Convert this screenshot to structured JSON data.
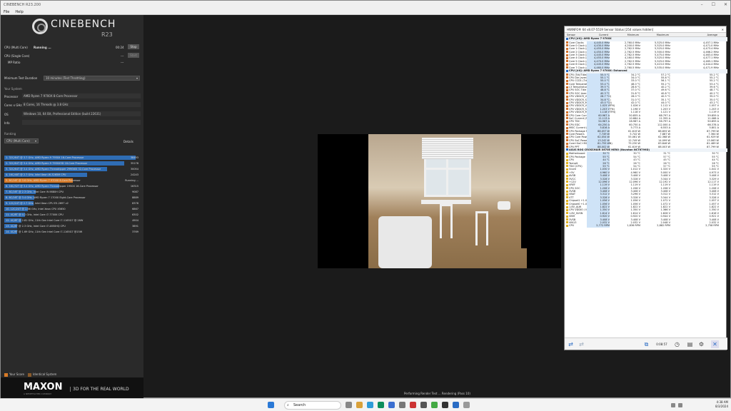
{
  "cinebench": {
    "window_title": "CINEBENCH R23.200",
    "menu": [
      "File",
      "Help"
    ],
    "brand": "CINEBENCH",
    "version": "R23",
    "multi_label": "CPU (Multi Core)",
    "multi_status": "Running ...",
    "multi_time": "00:24",
    "stop": "Stop",
    "single_label": "CPU (Single Core)",
    "single_value": "---",
    "start": "Start",
    "mp_label": "MP Ratio",
    "mp_value": "---",
    "min_test_label": "Minimum Test Duration",
    "min_test_value": "10 minutes (Test Throttling)",
    "system_label": "Your System",
    "processor_label": "Processor",
    "processor_value": "AMD Ryzen 7 9700X 8-Core Processor",
    "cores_label": "Cores x GHz",
    "cores_value": "8 Cores, 16 Threads @ 3.8 GHz",
    "os_label": "OS",
    "os_value": "Windows 10, 64 Bit, Professional Edition (build 22631)",
    "info_label": "Info",
    "info_value": "",
    "ranking_label": "Ranking",
    "ranking_select": "CPU (Multi Core)",
    "details": "Details",
    "ranking": [
      {
        "name": "1. 32C/64T @ 3.7 GHz, AMD Ryzen 9 7950X 16-Core Processor",
        "score": "38493",
        "pct": 100,
        "me": false
      },
      {
        "name": "2. 32C/64T @ 3.4 GHz, AMD Ryzen 9 7950X3D 16-Core Processor",
        "score": "35178",
        "pct": 91,
        "me": false
      },
      {
        "name": "3. 32C/64T @ 3.4 GHz, AMD Ryzen Threadripper 2990WX 32-Core Processor",
        "score": "30054",
        "pct": 78,
        "me": false
      },
      {
        "name": "4. 16C/48T @ 2.7 GHz, Intel Xeon W-3265M CPU",
        "score": "24243",
        "pct": 63,
        "me": false
      },
      {
        "name": "5. 8C/16T @ 3.8 GHz, AMD Ryzen 7 9700X 8-Core Processor",
        "score": "Running ...",
        "pct": 52,
        "me": true
      },
      {
        "name": "6. 16C/32T @ 3.4 GHz, AMD Ryzen Threadripper 1950X 16-Core Processor",
        "score": "16315",
        "pct": 42,
        "me": false
      },
      {
        "name": "7. 8C/16T @ 2.3 GHz, Intel Core i9-9880H CPU",
        "score": "9087",
        "pct": 24,
        "me": false
      },
      {
        "name": "8. 8C/16T @ 3.4 GHz, AMD Ryzen 7 1700X Eight-Core Processor",
        "score": "8889",
        "pct": 23,
        "me": false
      },
      {
        "name": "9. 12C/24T @ 2.7 GHz, Intel Xeon CPU E5-2697 v2",
        "score": "8378",
        "pct": 22,
        "me": false
      },
      {
        "name": "10. 12C/24T @ 2.66 GHz, Intel Xeon CPU X5650",
        "score": "6867",
        "pct": 18,
        "me": false
      },
      {
        "name": "11. 4C/8T @ 4.2 GHz, Intel Core i7-7700K CPU",
        "score": "6302",
        "pct": 16,
        "me": false
      },
      {
        "name": "12. 4C/8T @ 2.81 GHz, 11th Gen Intel Core i7-1165G7 @ 28W",
        "score": "4904",
        "pct": 13,
        "me": false
      },
      {
        "name": "13. 4C/8T @ 2.3 GHz, Intel Core i7-4850HQ CPU",
        "score": "3891",
        "pct": 10,
        "me": false
      },
      {
        "name": "14. 4C/8T @ 1.69 GHz, 11th Gen Intel Core i7-1165G7 @15W",
        "score": "3769",
        "pct": 10,
        "me": false
      }
    ],
    "legend_score": "Your Score",
    "legend_identical": "Identical System",
    "maxon": "MAXON",
    "maxon_sub": "A NEMETSCHEK COMPANY",
    "slogan": "3D FOR THE REAL WORLD",
    "status": "Performing Render Test ... Rendering (Pass 10)"
  },
  "hwinfo": {
    "title": "HWiNFO® 64 v8.07-5519 Sensor Status [254 values hidden]",
    "headers": [
      "Sensor",
      "Current",
      "Minimum",
      "Maximum",
      "Average"
    ],
    "rows": [
      {
        "g": true,
        "n": "CPU [#0]: AMD Ryzen 7 9700X"
      },
      {
        "n": "Core Clocks",
        "v": [
          "4,445.0 MHz",
          "2,760.0 MHz",
          "5,525.0 MHz",
          "4,457.1 MHz"
        ]
      },
      {
        "n": "Core 0 Clock (perf #1)",
        "v": [
          "4,430.0 MHz",
          "4,200.0 MHz",
          "5,525.0 MHz",
          "4,471.0 MHz"
        ]
      },
      {
        "n": "Core 1 Clock (perf #1)",
        "v": [
          "4,455.0 MHz",
          "2,762.5 MHz",
          "5,525.0 MHz",
          "4,473.4 MHz"
        ]
      },
      {
        "n": "Core 2 Clock (perf #2)",
        "v": [
          "4,450.0 MHz",
          "2,762.5 MHz",
          "5,500.0 MHz",
          "4,466.2 MHz"
        ]
      },
      {
        "n": "Core 3 Clock (perf #3)",
        "v": [
          "4,445.0 MHz",
          "2,762.5 MHz",
          "5,475.0 MHz",
          "4,463.4 MHz"
        ]
      },
      {
        "n": "Core 4 Clock (perf #1)",
        "v": [
          "4,455.0 MHz",
          "4,160.0 MHz",
          "5,525.0 MHz",
          "4,477.1 MHz"
        ]
      },
      {
        "n": "Core 5 Clock (perf #1)",
        "v": [
          "4,470.0 MHz",
          "2,762.5 MHz",
          "5,525.0 MHz",
          "4,465.1 MHz"
        ]
      },
      {
        "n": "Core 6 Clock (perf #4)",
        "v": [
          "4,445.0 MHz",
          "2,762.5 MHz",
          "5,415.0 MHz",
          "4,444.4 MHz"
        ]
      },
      {
        "n": "Core 7 Clock (perf #5)",
        "v": [
          "4,460.0 MHz",
          "2,760.5 MHz",
          "5,535.0 MHz",
          "4,471.9 MHz"
        ]
      },
      {
        "g": true,
        "n": "CPU [#0]: AMD Ryzen 7 9700X: Enhanced"
      },
      {
        "n": "CPU (Tctl/Tdie)",
        "v": [
          "55.5 °C",
          "34.2 °C",
          "57.2 °C",
          "55.2 °C"
        ]
      },
      {
        "n": "CPU Die (average)",
        "v": [
          "55.1 °C",
          "34.0 °C",
          "55.8 °C",
          "55.2 °C"
        ]
      },
      {
        "n": "CPU CCD1 (Tdie)",
        "v": [
          "55.0 °C",
          "33.0 °C",
          "56.1 °C",
          "55.2 °C"
        ]
      },
      {
        "n": "Core Temperatures",
        "v": [
          "53.4 °C",
          "48.0 °C",
          "55.2 °C",
          "53.4 °C"
        ]
      },
      {
        "n": "L3 Temperatures",
        "v": [
          "39.5 °C",
          "28.6 °C",
          "40.2 °C",
          "39.6 °C"
        ]
      },
      {
        "n": "CPU SOC Tdie",
        "v": [
          "48.8 °C",
          "37.0 °C",
          "49.6 °C",
          "48.7 °C"
        ]
      },
      {
        "n": "CPU SOC Average",
        "v": [
          "40.3 °C",
          "31.8 °C",
          "40.8 °C",
          "40.2 °C"
        ]
      },
      {
        "n": "CPU VDDCR_VDD VRM (SVI3 TFN)",
        "v": [
          "28.7 °C",
          "28.0 °C",
          "40.5 °C",
          "35.0 °C"
        ]
      },
      {
        "n": "CPU VDDCR_SOC VRM (SVI3 TFN)",
        "v": [
          "34.8 °C",
          "31.0 °C",
          "35.1 °C",
          "35.0 °C"
        ]
      },
      {
        "n": "CPU VDDCR_MISC VRM (SVI3 TFN)",
        "v": [
          "43.0 °C",
          "42.0 °C",
          "44.0 °C",
          "43.2 °C"
        ]
      },
      {
        "n": "CPU VDDCR_VDD Voltage (SVI3 TFN)",
        "v": [
          "1.025 V",
          "1.026 V",
          "1.112 V",
          "1.057 V"
        ]
      },
      {
        "n": "CPU VDDCR_SOC Voltage (SVI3 TFN)",
        "v": [
          "1.203 V",
          "1.198 V",
          "1.203 V",
          "1.203 V"
        ]
      },
      {
        "n": "CPU VDDCR_MISC Voltage (SVI3 TFN)",
        "v": [
          "1.118 V",
          "1.118 V",
          "1.121 V",
          "1.119 V"
        ]
      },
      {
        "n": "CPU Core Current (SVI3 TFN)",
        "v": [
          "60.967 A",
          "50.855 A",
          "68.797 A",
          "59.859 A"
        ]
      },
      {
        "n": "SoC Current (SVI3 TFN)",
        "v": [
          "11.113 A",
          "10.684 A",
          "11.355 A",
          "11.068 A"
        ]
      },
      {
        "n": "CPU TDC",
        "v": [
          "54.967 A",
          "28.987 A",
          "56.797 A",
          "50.859 A"
        ]
      },
      {
        "n": "CPU EDC",
        "v": [
          "64.250 A",
          "60.750 A",
          "112.000 A",
          "66.378 A"
        ]
      },
      {
        "n": "MISC Current (SVI3 TFN)",
        "v": [
          "5.816 A",
          "5.773 A",
          "6.553 A",
          "5.801 A"
        ]
      },
      {
        "n": "CPU Package Power",
        "v": [
          "88.057 W",
          "61.619 W",
          "88.855 W",
          "87.799 W"
        ]
      },
      {
        "n": "Core Powers",
        "v": [
          "7.749 W",
          "5.742 W",
          "7.887 W",
          "7.364 W"
        ]
      },
      {
        "n": "CPU Core Power (SVI3 TFN)",
        "v": [
          "62.054 W",
          "55.061 W",
          "62.368 W",
          "61.929 W"
        ]
      },
      {
        "n": "CPU SoC Power (SVI3 TFN)",
        "v": [
          "13.242 W",
          "12.749 W",
          "14.099 W",
          "13.063 W"
        ]
      },
      {
        "n": "Core+SoC+MISC Power (SVI3 TFN)",
        "v": [
          "81.755 W",
          "75.230 W",
          "83.846 W",
          "81.489 W"
        ]
      },
      {
        "n": "CPU PPT",
        "v": [
          "88.002 W",
          "61.619 W",
          "88.003 W",
          "87.799 W"
        ]
      },
      {
        "g": true,
        "n": "ASUS ROG CROSSHAIR X670E HERO (Nuvoton NCT6799D)"
      },
      {
        "n": "Motherboard",
        "v": [
          "30 °C",
          "30 °C",
          "31 °C",
          "30 °C"
        ]
      },
      {
        "n": "CPU Package",
        "v": [
          "55 °C",
          "54 °C",
          "57 °C",
          "55 °C"
        ]
      },
      {
        "n": "CPU",
        "v": [
          "44 °C",
          "43 °C",
          "45 °C",
          "44 °C"
        ]
      },
      {
        "n": "Tsenplt",
        "v": [
          "26 °C",
          "26 °C",
          "26 °C",
          "26 °C"
        ]
      },
      {
        "n": "TSI0 (CPU)",
        "v": [
          "55 °C",
          "54 °C",
          "57 °C",
          "55 °C"
        ]
      },
      {
        "n": "Vcore",
        "v": [
          "1.030 V",
          "1.012 V",
          "1.320 V",
          "1.041 V"
        ]
      },
      {
        "n": "+5V",
        "v": [
          "4.960 V",
          "4.960 V",
          "5.000 V",
          "4.973 V"
        ]
      },
      {
        "n": "AVSB",
        "v": [
          "3.408 V",
          "3.408 V",
          "3.408 V",
          "3.408 V"
        ]
      },
      {
        "n": "3VCC",
        "v": [
          "3.328 V",
          "3.328 V",
          "3.344 V",
          "3.329 V"
        ]
      },
      {
        "n": "+12V",
        "v": [
          "12.096 V",
          "12.096 V",
          "12.192 V",
          "12.117 V"
        ]
      },
      {
        "n": "VREF",
        "v": [
          "1.119 V",
          "1.119 V",
          "1.119 V",
          "1.119 V"
        ]
      },
      {
        "n": "CPU SOC",
        "v": [
          "1.208 V",
          "1.208 V",
          "1.208 V",
          "1.208 V"
        ]
      },
      {
        "n": "3VSB",
        "v": [
          "3.408 V",
          "3.408 V",
          "3.408 V",
          "3.408 V"
        ]
      },
      {
        "n": "VBAT",
        "v": [
          "3.312 V",
          "3.296 V",
          "3.312 V",
          "3.312 V"
        ]
      },
      {
        "n": "VTT",
        "v": [
          "3.328 V",
          "3.328 V",
          "3.344 V",
          "3.328 V"
        ]
      },
      {
        "n": "Chipset1 +1.05V",
        "v": [
          "1.056 V",
          "1.056 V",
          "1.072 V",
          "1.057 V"
        ]
      },
      {
        "n": "Chipset0 +1.05V",
        "v": [
          "1.056 V",
          "1.056 V",
          "1.072 V",
          "1.057 V"
        ]
      },
      {
        "n": "1.8V_ALW",
        "v": [
          "1.822 V",
          "1.822 V",
          "1.822 V",
          "1.822 V"
        ]
      },
      {
        "n": "CPU VDDIO / MC",
        "v": [
          "1.350 V",
          "1.350 V",
          "1.366 V",
          "1.350 V"
        ]
      },
      {
        "n": "1.8V_SUSN",
        "v": [
          "1.814 V",
          "1.814 V",
          "1.826 V",
          "1.816 V"
        ]
      },
      {
        "n": "VIN9",
        "v": [
          "0.920 V",
          "0.920 V",
          "0.944 V",
          "0.921 V"
        ]
      },
      {
        "n": "3VSB",
        "v": [
          "3.408 V",
          "3.408 V",
          "3.408 V",
          "3.408 V"
        ]
      },
      {
        "n": "VIN13",
        "v": [
          "2.032 V",
          "2.032 V",
          "2.048 V",
          "2.032 V"
        ]
      },
      {
        "n": "CPU",
        "v": [
          "2,772 RPM",
          "1,836 RPM",
          "2,882 RPM",
          "2,758 RPM"
        ]
      }
    ],
    "timer": "0:08:57"
  },
  "taskbar": {
    "search": "Search",
    "time": "4:38 AM",
    "date": "8/3/2024"
  }
}
